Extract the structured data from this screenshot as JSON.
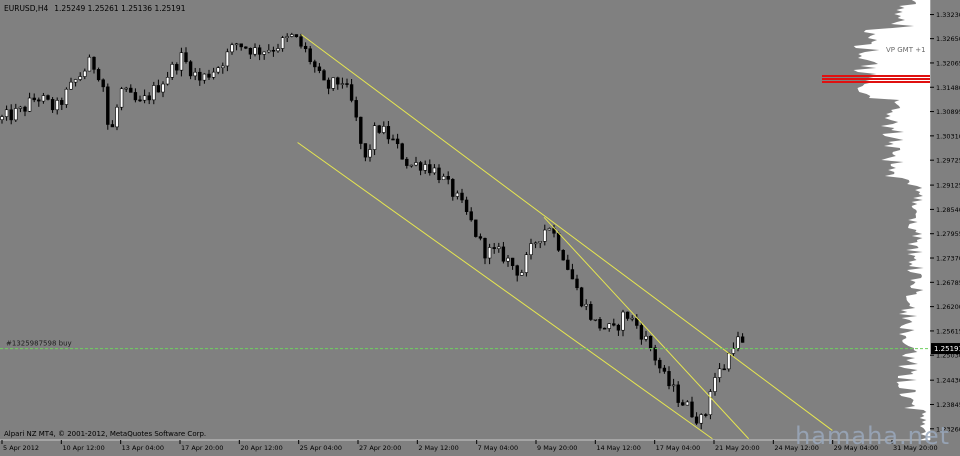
{
  "header": {
    "symbol": "EURUSD,H4",
    "ohlc": "1.25249 1.25261 1.25136 1.25191"
  },
  "footer": {
    "copyright": "Alpari NZ MT4, © 2001-2012, MetaQuotes Software Corp."
  },
  "watermark": "hamaha.net",
  "colors": {
    "background": "#808080",
    "candle": "#000000",
    "channel": "#e6e650",
    "order_line": "#6fcf5f",
    "price_tag": "#000000",
    "vp_profile": "#ffffff",
    "vp_marker": "#e01010"
  },
  "chart_data": {
    "type": "candlestick",
    "ylim": [
      1.2299,
      1.3358
    ],
    "price_ticks": [
      "1.33230",
      "1.32650",
      "1.32065",
      "1.31480",
      "1.30895",
      "1.30310",
      "1.29725",
      "1.29125",
      "1.28540",
      "1.27955",
      "1.27370",
      "1.26785",
      "1.26200",
      "1.25615",
      "1.25030",
      "1.24430",
      "1.23845",
      "1.23260"
    ],
    "time_ticks": [
      "5 Apr 2012",
      "10 Apr 12:00",
      "13 Apr 04:00",
      "17 Apr 20:00",
      "20 Apr 12:00",
      "25 Apr 04:00",
      "27 Apr 20:00",
      "2 May 12:00",
      "7 May 04:00",
      "9 May 20:00",
      "14 May 12:00",
      "17 May 04:00",
      "21 May 20:00",
      "24 May 12:00",
      "29 May 04:00",
      "31 May 20:00"
    ],
    "current_price": "1.25191",
    "order_label": "#1325987598 buy",
    "order_price": 1.2519,
    "volume_profile_label": "VP GMT +1",
    "channels": [
      {
        "from": [
          0.324,
          1.3275
        ],
        "to": [
          0.895,
          1.2322
        ]
      },
      {
        "from": [
          0.32,
          1.3015
        ],
        "to": [
          0.766,
          1.2302
        ]
      },
      {
        "from": [
          0.585,
          1.2835
        ],
        "to": [
          0.805,
          1.2302
        ]
      }
    ],
    "path": [
      [
        0.0,
        1.307
      ],
      [
        0.022,
        1.309
      ],
      [
        0.04,
        1.3125
      ],
      [
        0.06,
        1.3095
      ],
      [
        0.08,
        1.316
      ],
      [
        0.098,
        1.321
      ],
      [
        0.11,
        1.317
      ],
      [
        0.118,
        1.302
      ],
      [
        0.13,
        1.314
      ],
      [
        0.15,
        1.3105
      ],
      [
        0.17,
        1.315
      ],
      [
        0.195,
        1.322
      ],
      [
        0.215,
        1.3165
      ],
      [
        0.235,
        1.32
      ],
      [
        0.255,
        1.3255
      ],
      [
        0.275,
        1.3235
      ],
      [
        0.295,
        1.3245
      ],
      [
        0.315,
        1.327
      ],
      [
        0.33,
        1.323
      ],
      [
        0.35,
        1.3145
      ],
      [
        0.368,
        1.3165
      ],
      [
        0.38,
        1.31
      ],
      [
        0.392,
        1.2965
      ],
      [
        0.405,
        1.3055
      ],
      [
        0.42,
        1.3025
      ],
      [
        0.44,
        1.296
      ],
      [
        0.455,
        1.2965
      ],
      [
        0.47,
        1.2945
      ],
      [
        0.49,
        1.2885
      ],
      [
        0.505,
        1.283
      ],
      [
        0.52,
        1.2755
      ],
      [
        0.54,
        1.2745
      ],
      [
        0.56,
        1.27
      ],
      [
        0.575,
        1.2775
      ],
      [
        0.59,
        1.282
      ],
      [
        0.605,
        1.275
      ],
      [
        0.62,
        1.266
      ],
      [
        0.64,
        1.258
      ],
      [
        0.66,
        1.256
      ],
      [
        0.672,
        1.2605
      ],
      [
        0.685,
        1.2575
      ],
      [
        0.7,
        1.252
      ],
      [
        0.715,
        1.2445
      ],
      [
        0.73,
        1.24
      ],
      [
        0.745,
        1.2365
      ],
      [
        0.757,
        1.234
      ],
      [
        0.765,
        1.244
      ],
      [
        0.78,
        1.248
      ],
      [
        0.79,
        1.2545
      ],
      [
        0.8,
        1.2522
      ]
    ]
  }
}
